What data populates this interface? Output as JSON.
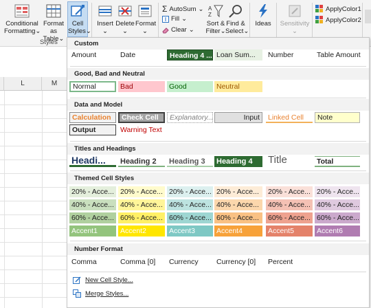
{
  "ribbon": {
    "conditional_formatting": "Conditional Formatting",
    "conditional_label1": "Conditional",
    "conditional_label2": "Formatting",
    "format_table1": "Format as",
    "format_table2": "Table",
    "cell_styles1": "Cell",
    "cell_styles2": "Styles",
    "styles_group": "Styles",
    "insert": "Insert",
    "delete": "Delete",
    "format": "Format",
    "autosum": "AutoSum",
    "fill": "Fill",
    "clear": "Clear",
    "sort1": "Sort &",
    "sort2": "Filter",
    "find1": "Find &",
    "find2": "Select",
    "ideas": "Ideas",
    "sensitivity": "Sensitivity",
    "apply1": "ApplyColor1",
    "apply2": "ApplyColor2",
    "dropdown_arrow": "⌄"
  },
  "sheet": {
    "col_l": "L",
    "col_m": "M"
  },
  "gallery": {
    "custom": {
      "title": "Custom",
      "cells": [
        "Amount",
        "Date",
        "Heading 4 ...",
        "Loan Sum...",
        "Number",
        "Table Amount"
      ]
    },
    "good_bad": {
      "title": "Good, Bad and Neutral",
      "cells": [
        "Normal",
        "Bad",
        "Good",
        "Neutral"
      ]
    },
    "data_model": {
      "title": "Data and Model",
      "row1": [
        "Calculation",
        "Check Cell",
        "Explanatory...",
        "Input",
        "Linked Cell",
        "Note"
      ],
      "row2": [
        "Output",
        "Warning Text"
      ]
    },
    "titles": {
      "title": "Titles and Headings",
      "cells": [
        "Headi...",
        "Heading 2",
        "Heading 3",
        "Heading 4",
        "Title",
        "Total"
      ]
    },
    "themed": {
      "title": "Themed Cell Styles",
      "row20": [
        "20% - Acce...",
        "20% - Acce...",
        "20% - Acce...",
        "20% - Acce...",
        "20% - Acce...",
        "20% - Acce..."
      ],
      "row40": [
        "40% - Acce...",
        "40% - Acce...",
        "40% - Acce...",
        "40% - Acce...",
        "40% - Acce...",
        "40% - Acce..."
      ],
      "row60": [
        "60% - Acce...",
        "60% - Acce...",
        "60% - Acce...",
        "60% - Acce...",
        "60% - Acce...",
        "60% - Acce..."
      ],
      "accent": [
        "Accent1",
        "Accent2",
        "Accent3",
        "Accent4",
        "Accent5",
        "Accent6"
      ]
    },
    "number": {
      "title": "Number Format",
      "cells": [
        "Comma",
        "Comma [0]",
        "Currency",
        "Currency [0]",
        "Percent"
      ]
    },
    "new_style": "New Cell Style...",
    "merge_styles": "Merge Styles..."
  },
  "colors": {
    "heading4_bg": "#2e6b32",
    "bad_bg": "#ffc7ce",
    "good_bg": "#c6efce",
    "neutral_bg": "#ffeb9c",
    "calc_text": "#e9822f",
    "check_bg": "#a5a5a5",
    "input_bg": "#e0e0e0",
    "note_bg": "#ffffcc",
    "warning_text": "#c00000",
    "accent1": "#93c47d",
    "accent2": "#ffe600",
    "accent3": "#7ec8c4",
    "accent4": "#f7a23a",
    "accent5": "#e4826a",
    "accent6": "#b07cb1"
  }
}
